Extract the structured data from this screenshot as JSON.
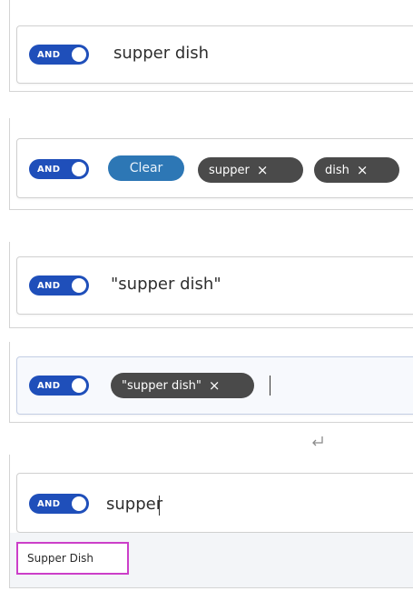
{
  "colors": {
    "toggle_bg": "#1f4fba",
    "chip_bg": "#4a4a4a",
    "clear_bg": "#2d77b5",
    "highlight_border": "#cc3fc9"
  },
  "state1": {
    "toggle_label": "AND",
    "query": "supper dish"
  },
  "state2": {
    "toggle_label": "AND",
    "clear_label": "Clear",
    "chips": [
      {
        "label": "supper",
        "remove_icon": "×"
      },
      {
        "label": "dish",
        "remove_icon": "×"
      }
    ]
  },
  "state3": {
    "toggle_label": "AND",
    "query": "\"supper dish\""
  },
  "state4": {
    "toggle_label": "AND",
    "chips": [
      {
        "label": "\"supper dish\"",
        "remove_icon": "×"
      }
    ]
  },
  "enter_icon": "return-arrow-icon",
  "state5": {
    "toggle_label": "AND",
    "query": "supper",
    "suggestion": "Supper Dish"
  }
}
